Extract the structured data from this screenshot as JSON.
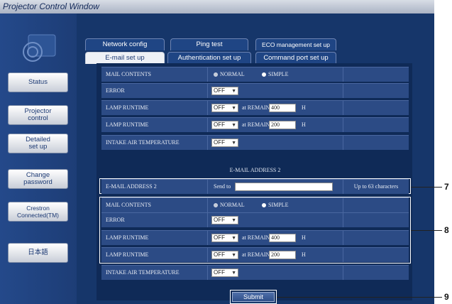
{
  "window_title": "Projector Control Window",
  "nav": [
    {
      "label": "Status"
    },
    {
      "label": "Projector\ncontrol"
    },
    {
      "label": "Detailed\nset up"
    },
    {
      "label": "Change\npassword"
    },
    {
      "label": "Crestron\nConnected(TM)"
    },
    {
      "label": "日本語"
    }
  ],
  "tabs_row1": [
    "Network config",
    "Ping test",
    "ECO management set up"
  ],
  "tabs_row2": [
    "E-mail set up",
    "Authentication set up",
    "Command port set up"
  ],
  "active_tab": "E-mail set up",
  "group1": {
    "mail_contents_label": "MAIL CONTENTS",
    "radio_normal": "NORMAL",
    "radio_simple": "SIMPLE",
    "selected": "SIMPLE",
    "error_label": "ERROR",
    "error_value": "OFF",
    "lamp1_label": "LAMP RUNTIME",
    "lamp1_value": "OFF",
    "lamp1_remain_label": "at REMAIN",
    "lamp1_remain": "400",
    "lamp1_unit": "H",
    "lamp2_label": "LAMP RUNTIME",
    "lamp2_value": "OFF",
    "lamp2_remain_label": "at REMAIN",
    "lamp2_remain": "200",
    "lamp2_unit": "H",
    "intake_label": "INTAKE AIR TEMPERATURE",
    "intake_value": "OFF"
  },
  "section2_heading": "E-MAIL ADDRESS 2",
  "address2": {
    "label": "E-MAIL ADDRESS 2",
    "send_to": "Send to",
    "value": "",
    "hint": "Up to 63 characters"
  },
  "group2": {
    "mail_contents_label": "MAIL CONTENTS",
    "radio_normal": "NORMAL",
    "radio_simple": "SIMPLE",
    "selected": "SIMPLE",
    "error_label": "ERROR",
    "error_value": "OFF",
    "lamp1_label": "LAMP RUNTIME",
    "lamp1_value": "OFF",
    "lamp1_remain_label": "at REMAIN",
    "lamp1_remain": "400",
    "lamp1_unit": "H",
    "lamp2_label": "LAMP RUNTIME",
    "lamp2_value": "OFF",
    "lamp2_remain_label": "at REMAIN",
    "lamp2_remain": "200",
    "lamp2_unit": "H",
    "intake_label": "INTAKE AIR TEMPERATURE",
    "intake_value": "OFF"
  },
  "submit_label": "Submit",
  "callouts": [
    "7",
    "8",
    "9"
  ],
  "colors": {
    "window_bg": "#16366a",
    "row_bg": "#2c4b85",
    "active_tab": "#eef1f6"
  }
}
